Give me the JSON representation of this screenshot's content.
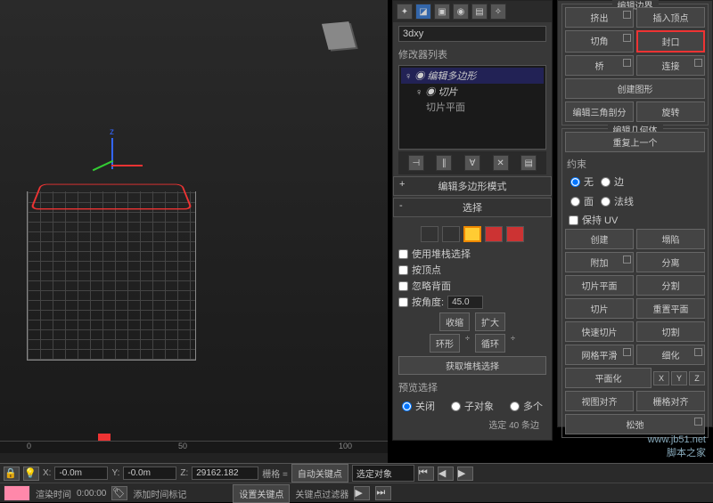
{
  "object_name": "3dxy",
  "modifier_label": "修改器列表",
  "modifiers": {
    "m0": "编辑多边形",
    "m1": "切片",
    "m2": "切片平面"
  },
  "rollouts": {
    "edit_mode": "编辑多边形模式",
    "select": "选择",
    "edit_border": "编辑边界",
    "edit_geom": "编辑几何体"
  },
  "sel": {
    "use_stack": "使用堆栈选择",
    "by_vertex": "按顶点",
    "ignore_back": "忽略背面",
    "by_angle": "按角度:",
    "angle_val": "45.0",
    "shrink": "收缩",
    "grow": "扩大",
    "ring": "环形",
    "loop": "循环",
    "get_stack": "获取堆栈选择",
    "preview": "预览选择",
    "pv_off": "关闭",
    "pv_sub": "子对象",
    "pv_multi": "多个",
    "count": "选定 40 条边"
  },
  "edge": {
    "extrude": "挤出",
    "insert_v": "插入顶点",
    "chamfer": "切角",
    "cap": "封口",
    "bridge": "桥",
    "connect": "连接",
    "create_shape": "创建图形",
    "tri": "编辑三角剖分",
    "rotate": "旋转"
  },
  "geom": {
    "repeat": "重复上一个",
    "constrain": "约束",
    "c_none": "无",
    "c_edge": "边",
    "c_face": "面",
    "c_normal": "法线",
    "preserve_uv": "保持 UV",
    "create": "创建",
    "collapse": "塌陷",
    "attach": "附加",
    "detach": "分离",
    "slice_plane": "切片平面",
    "split": "分割",
    "slice": "切片",
    "reset_plane": "重置平面",
    "quick_slice": "快速切片",
    "cut": "切割",
    "msmooth": "网格平滑",
    "tess": "细化",
    "planar": "平面化",
    "x": "X",
    "y": "Y",
    "z": "Z",
    "view_align": "视图对齐",
    "grid_align": "栅格对齐",
    "relax": "松弛"
  },
  "timeline": {
    "t0": "0",
    "t50": "50",
    "t100": "100"
  },
  "status": {
    "x_lbl": "X:",
    "x": "-0.0m",
    "y_lbl": "Y:",
    "y": "-0.0m",
    "z_lbl": "Z:",
    "z": "29162.182",
    "grid": "栅格 =",
    "auto_key": "自动关键点",
    "sel_obj": "选定对象",
    "render_time": "渲染时间",
    "time_val": "0:00:00",
    "add_tag": "添加时间标记",
    "set_key": "设置关键点",
    "key_filter": "关键点过滤器"
  },
  "watermark": {
    "l1": "www.jb51.net",
    "l2": "脚本之家"
  }
}
